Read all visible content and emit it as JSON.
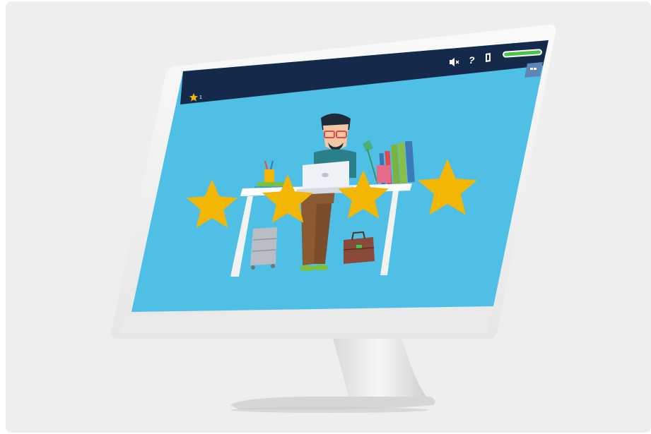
{
  "app": {
    "score_count": "1"
  },
  "topbar": {
    "mute_icon": "speaker-mute-icon",
    "help_label": "?",
    "book_icon": "book-icon",
    "progress": 1.0,
    "menu_icon": "menu-icon"
  },
  "scene": {
    "stars": 4,
    "background_color": "#4fbfe6"
  },
  "colors": {
    "topbar": "#15294a",
    "screen_bg": "#4fbfe6",
    "star": "#f2b705",
    "progress": "#4cc34a",
    "menu_button": "#5d86b4"
  }
}
